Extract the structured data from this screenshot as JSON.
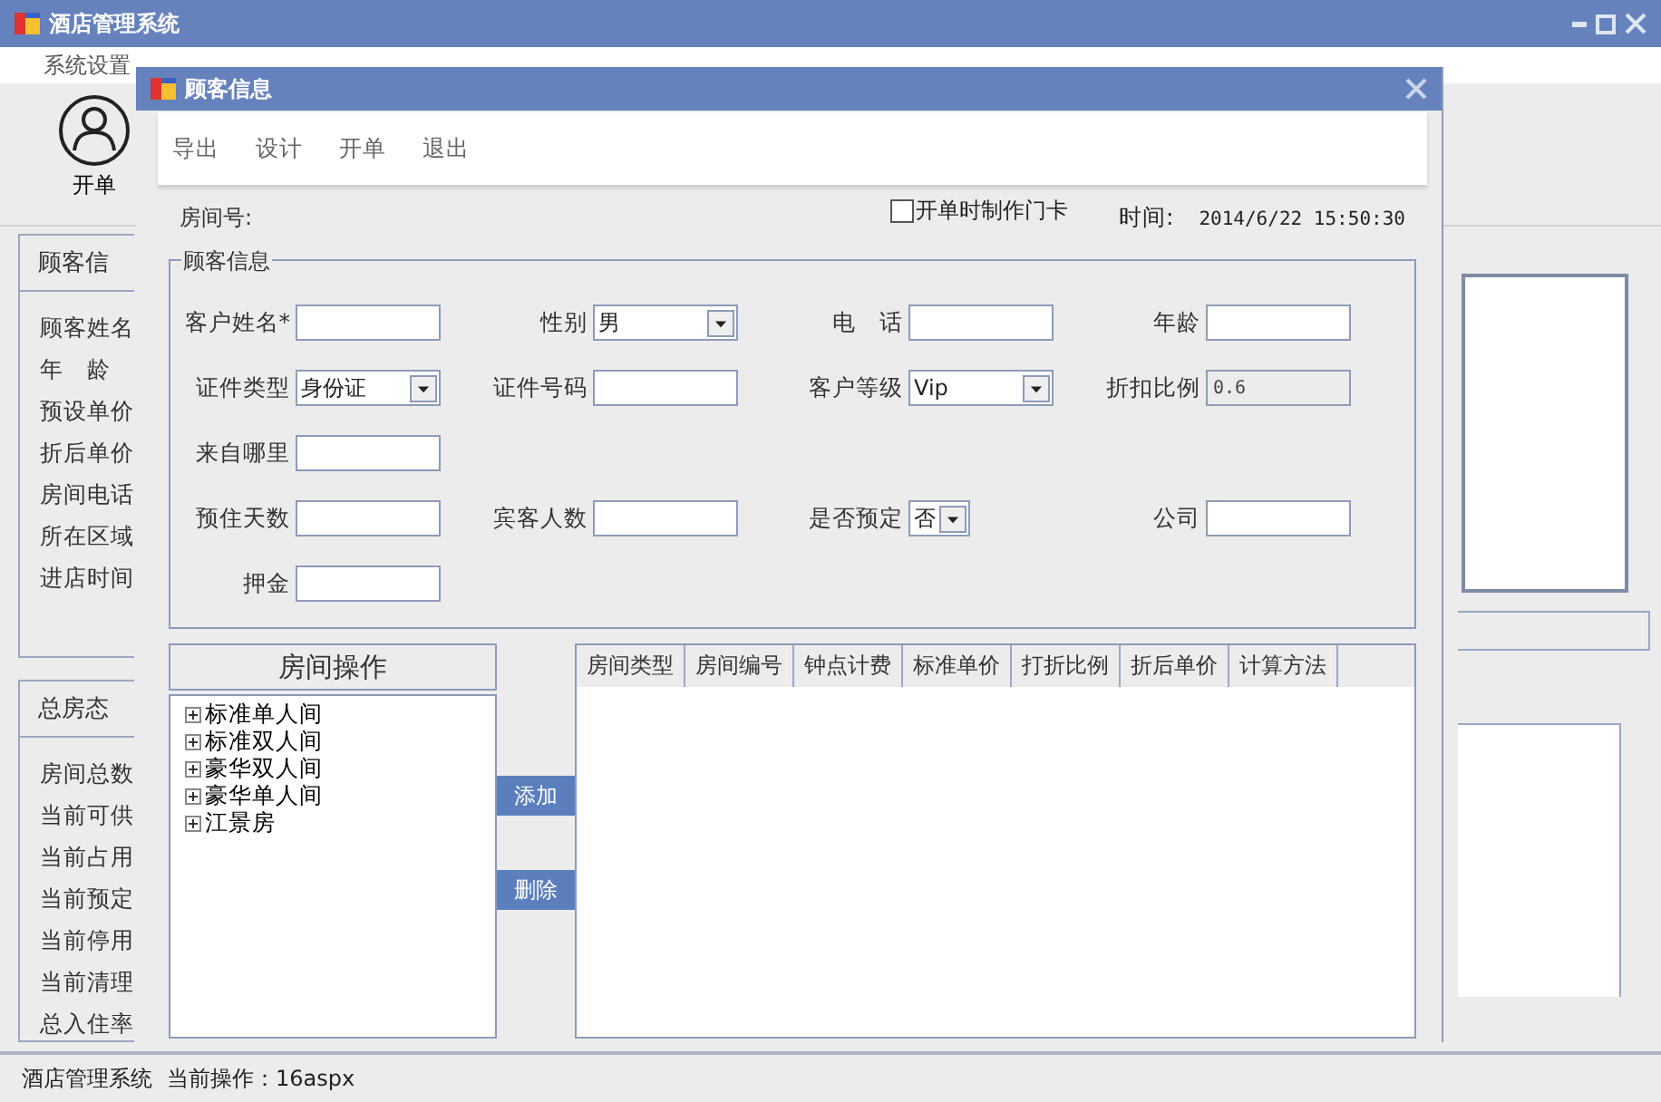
{
  "main_window": {
    "title": "酒店管理系统",
    "menu": [
      "系统设置"
    ],
    "toolbar": [
      {
        "label": "开单"
      }
    ],
    "customer_panel": {
      "title": "顾客信",
      "labels": [
        "顾客姓名",
        "年　龄",
        "预设单价",
        "折后单价",
        "房间电话",
        "所在区域",
        "进店时间"
      ]
    },
    "room_status_panel": {
      "title": "总房态",
      "labels": [
        "房间总数",
        "当前可供",
        "当前占用",
        "当前预定",
        "当前停用",
        "当前清理",
        "总入住率"
      ]
    },
    "status_bar": {
      "app": "酒店管理系统",
      "operation": "当前操作：16aspx"
    }
  },
  "dialog": {
    "title": "顾客信息",
    "toolbar": [
      "导出",
      "设计",
      "开单",
      "退出"
    ],
    "room_no_label": "房间号:",
    "card_checkbox": {
      "label": "开单时制作门卡",
      "checked": false
    },
    "time_label": "时间:",
    "time_value": "2014/6/22 15:50:30",
    "group_title": "顾客信息",
    "rows": [
      [
        {
          "label": "客户姓名*",
          "kind": "input"
        },
        {
          "label": "性别",
          "kind": "select",
          "value": "男"
        },
        {
          "label": "电　话",
          "kind": "input"
        },
        {
          "label": "年龄",
          "kind": "input"
        }
      ],
      [
        {
          "label": "证件类型",
          "kind": "select",
          "value": "身份证"
        },
        {
          "label": "证件号码",
          "kind": "input"
        },
        {
          "label": "客户等级",
          "kind": "select",
          "value": "Vip"
        },
        {
          "label": "折扣比例",
          "kind": "readonly",
          "value": "0.6"
        }
      ],
      [
        {
          "label": "来自哪里",
          "kind": "input"
        }
      ],
      [
        {
          "label": "预住天数",
          "kind": "input"
        },
        {
          "label": "宾客人数",
          "kind": "input"
        },
        {
          "label": "是否预定",
          "kind": "smallselect",
          "value": "否"
        },
        {
          "label": "公司",
          "kind": "input"
        }
      ],
      [
        {
          "label": "押金",
          "kind": "input"
        }
      ]
    ],
    "tree": {
      "title": "房间操作",
      "items": [
        {
          "label": "标准单人间",
          "expanded": false
        },
        {
          "label": "标准双人间",
          "expanded": false
        },
        {
          "label": "豪华双人间",
          "expanded": false
        },
        {
          "label": "豪华单人间",
          "expanded": false
        },
        {
          "label": "江景房",
          "expanded": false
        }
      ]
    },
    "buttons": [
      "添加",
      "删除"
    ],
    "grid": {
      "columns": [
        "房间类型",
        "房间编号",
        "钟点计费",
        "标准单价",
        "打折比例",
        "折后单价",
        "计算方法"
      ]
    }
  }
}
